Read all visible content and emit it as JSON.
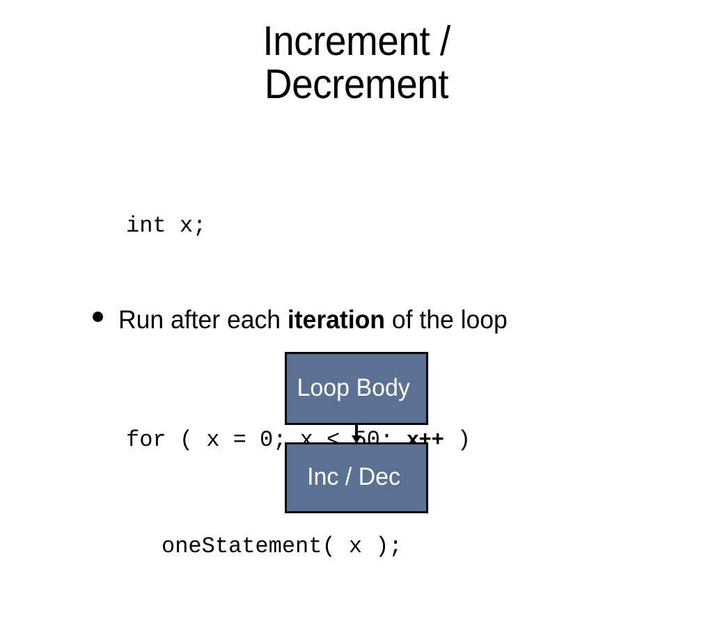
{
  "slide": {
    "title": "Increment /\nDecrement",
    "background_color": "#ffffff",
    "text_color": "#000000"
  },
  "code": {
    "line1": "int x;",
    "line2_prefix": "for ( x = 0; x < 50; ",
    "line2_emphasis": "x++",
    "line2_suffix": " )",
    "line3": "oneStatement( x );"
  },
  "bullet": {
    "marker": "bullet-dot",
    "text_before": "Run after each ",
    "text_emphasis": "iteration",
    "text_after": " of the loop"
  },
  "diagram": {
    "box_fill_color": "#5b7193",
    "box_border_color": "#000000",
    "box_text_color": "#ffffff",
    "top_box_label": "Loop Body",
    "bottom_box_label": "Inc / Dec",
    "arrow_direction": "down"
  }
}
